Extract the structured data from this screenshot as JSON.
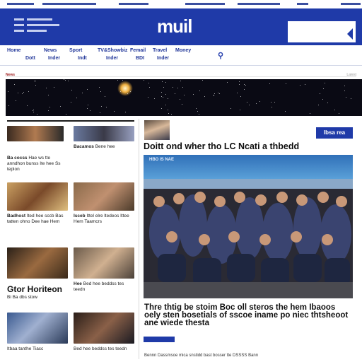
{
  "site": {
    "brand": "muil"
  },
  "nav": {
    "row1": [
      "Home",
      "News",
      "Sport",
      "TV&Showbiz",
      "Femail",
      "Travel",
      "Money"
    ],
    "row2": [
      "Dott",
      "Inder",
      "Indt",
      "Inder",
      "BDI",
      "Inder"
    ],
    "search_icon": "search-icon"
  },
  "banner": {
    "left_label": "News",
    "right_label": "Latest"
  },
  "left_column": {
    "stories": [
      {
        "title": "Ba cocss",
        "text": "Hae ws tte anndhon bunss Ite hee Ss teplon"
      },
      {
        "title": "Bacamos",
        "text": "Bene hee"
      },
      {
        "title": "Badhost",
        "text": "Ited hee sccb Bas tatten ohno Dee hae Hem"
      },
      {
        "title": "Isceb",
        "text": "Ittel elre ltedeos Ittee Hem Taamcrs"
      },
      {
        "title": "Gtor Horiteon",
        "text": "Bi Ba dbs stow"
      },
      {
        "title": "Hee",
        "text": "Bed hee beddss tes teedn"
      },
      {
        "title": "Bed",
        "text": "Itbaa tanthe Tiacc"
      }
    ]
  },
  "main": {
    "headline": "Doitt ond wher tho LC Ncati a thbedd",
    "badge": "Ibsa rea",
    "image_caption": "HBO IS NAE",
    "summary": "Thre thtig be stoim Boc oll steros the hem Ibaoos oely sten bosetials of sscoe iname po niec thtsheoot ane wiede thesta",
    "footer": "Bennn Dassmsoe mica snstidd bast bosser tte DSSSS Bann"
  },
  "colors": {
    "brand_blue": "#1f3aa8",
    "link_blue": "#23389a"
  }
}
